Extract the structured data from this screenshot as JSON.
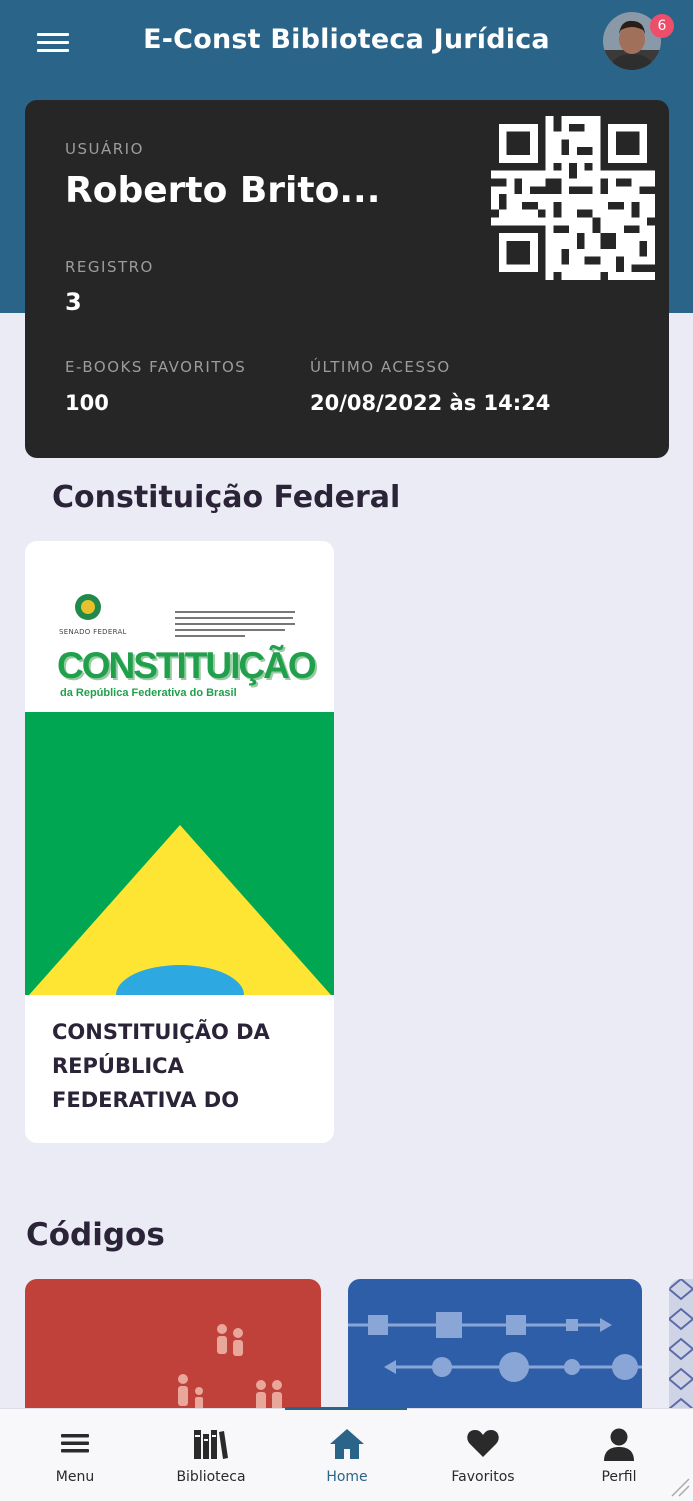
{
  "app": {
    "title": "E-Const Biblioteca Jurídica"
  },
  "notifications": {
    "count": "6"
  },
  "user_card": {
    "user_label": "USUÁRIO",
    "user_name": "Roberto Brito...",
    "registro_label": "REGISTRO",
    "registro_value": "3",
    "favoritos_label": "E-BOOKS FAVORITOS",
    "favoritos_value": "100",
    "acesso_label": "ÚLTIMO ACESSO",
    "acesso_value": "20/08/2022 às 14:24"
  },
  "constituicao": {
    "section_title": "Constituição Federal",
    "book": {
      "cover_publisher": "SENADO FEDERAL",
      "cover_title": "CONSTITUIÇÃO",
      "cover_subtitle": "da República Federativa do Brasil",
      "title_lines": [
        "CONSTITUIÇÃO DA",
        "REPÚBLICA",
        "FEDERATIVA DO"
      ]
    }
  },
  "codigos": {
    "section_title": "Códigos"
  },
  "nav": {
    "items": [
      {
        "label": "Menu",
        "icon": "menu-icon"
      },
      {
        "label": "Biblioteca",
        "icon": "books-icon"
      },
      {
        "label": "Home",
        "icon": "home-icon"
      },
      {
        "label": "Favoritos",
        "icon": "heart-icon"
      },
      {
        "label": "Perfil",
        "icon": "person-icon"
      }
    ],
    "active": "Home"
  },
  "colors": {
    "header": "#2a6488",
    "card": "#262626",
    "background": "#ebebf5",
    "badge": "#ef4e6a",
    "code_red": "#c0413a",
    "code_blue": "#2e5ea8"
  }
}
